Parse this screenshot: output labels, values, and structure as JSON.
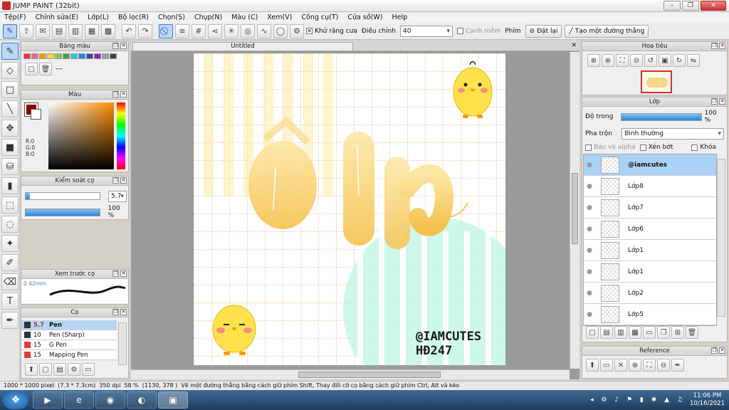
{
  "window": {
    "title": "JUMP PAINT (32bit)",
    "min": "–",
    "max": "❐",
    "close": "✕"
  },
  "menu": [
    "Tệp(F)",
    "Chỉnh sửa(E)",
    "Lớp(L)",
    "Bộ lọc(R)",
    "Chọn(S)",
    "Chụp(N)",
    "Màu (C)",
    "Xem(V)",
    "Công cụ(T)",
    "Cửa số(W)",
    "Help"
  ],
  "toolbar": {
    "antialias_label": "Khử răng cưa",
    "adjust_label": "Điều chỉnh",
    "adjust_value": "40",
    "smooth_label": "Cạnh mềm",
    "key_label": "Phím",
    "reset_label": "Đặt lại",
    "line_label": "Tạo một đường thẳng"
  },
  "panels": {
    "palette_title": "Bảng màu",
    "palette_text": "---",
    "palette_colors": [
      "#e53935",
      "#f06292",
      "#ff9800",
      "#fdd835",
      "#8bc34a",
      "#43a047",
      "#26c6da",
      "#1e88e5",
      "#3949ab",
      "#8e24aa",
      "#9e9e9e",
      "#424242"
    ],
    "color_title": "Màu",
    "rgb": [
      "R:0",
      "G:0",
      "B:0"
    ],
    "brush_control_title": "Kiểm soát cọ",
    "brush_size": "5.7",
    "brush_opacity": "100 %",
    "brush_opacity_fraction": 1.0,
    "preview_title": "Xem trước cọ",
    "preview_size": "0.42mm",
    "brush_title": "Cọ",
    "brushes": [
      {
        "size": "5.7",
        "name": "Pen",
        "color": "#333333",
        "selected": true
      },
      {
        "size": "10",
        "name": "Pen (Sharp)",
        "color": "#333333",
        "selected": false
      },
      {
        "size": "15",
        "name": "G Pen",
        "color": "#e53935",
        "selected": false
      },
      {
        "size": "15",
        "name": "Mapping Pen",
        "color": "#e53935",
        "selected": false
      }
    ]
  },
  "canvas": {
    "tab_title": "Untitled",
    "close": "✕",
    "art_lines": [
      "@IAMCUTES",
      "HĐ247"
    ]
  },
  "right": {
    "navigator_title": "Hoa tiêu",
    "layer_title": "Lớp",
    "opacity_label": "Độ trong",
    "opacity_value": "100 %",
    "opacity_fraction": 1.0,
    "blend_label": "Pha trộn",
    "blend_value": "Bình thường",
    "protect_alpha": "Bảo vệ alpha",
    "clip": "Xén bớt",
    "lock": "Khóa",
    "layers": [
      {
        "name": "@iamcutes",
        "selected": true
      },
      {
        "name": "Lớp8",
        "selected": false
      },
      {
        "name": "Lớp7",
        "selected": false
      },
      {
        "name": "Lớp6",
        "selected": false
      },
      {
        "name": "Lớp1",
        "selected": false
      },
      {
        "name": "Lớp1",
        "selected": false
      },
      {
        "name": "Lớp2",
        "selected": false
      },
      {
        "name": "Lớp5",
        "selected": false
      }
    ],
    "reference_title": "Reference"
  },
  "status": {
    "size": "1000 * 1000 pixel",
    "cm": "(7.3 * 7.3cm)",
    "dpi": "350 dpi",
    "zoom": "58 %",
    "coords": "(1130, 378 )",
    "hint": "Vẽ một đường thẳng bằng cách giữ phím Shift, Thay đổi cỡ cọ bằng cách giữ phím Ctrl, Alt và kéo"
  },
  "taskbar": {
    "time": "11:06 PM",
    "date": "10/16/2021"
  }
}
